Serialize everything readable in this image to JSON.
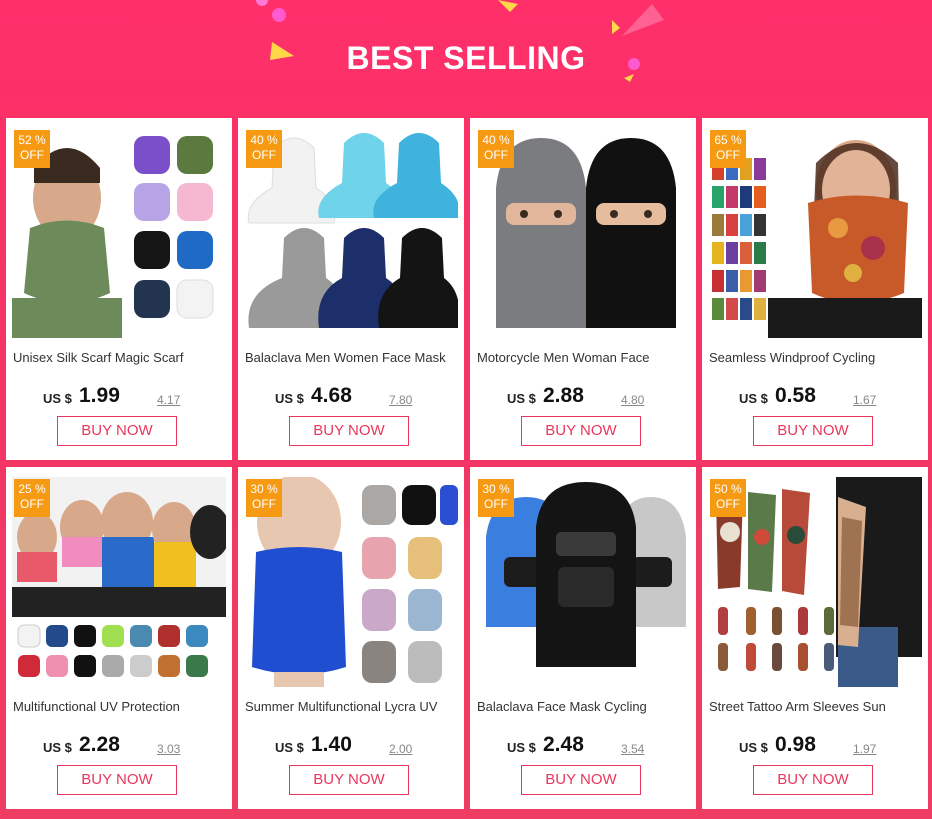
{
  "header": {
    "title": "BEST SELLING"
  },
  "colors": {
    "accent": "#e8385c",
    "badge": "#f59a12",
    "background": "#f43565"
  },
  "products": [
    {
      "badge_pct": "52 %",
      "badge_off": "OFF",
      "name": "Unisex Silk Scarf Magic Scarf",
      "currency": "US $",
      "price": "1.99",
      "old_price": "4.17",
      "buy_label": "BUY NOW",
      "image": "neck-gaiter-colors"
    },
    {
      "badge_pct": "40 %",
      "badge_off": "OFF",
      "name": "Balaclava Men Women Face Mask",
      "currency": "US $",
      "price": "4.68",
      "old_price": "7.80",
      "buy_label": "BUY NOW",
      "image": "balaclava-colors"
    },
    {
      "badge_pct": "40 %",
      "badge_off": "OFF",
      "name": "Motorcycle Men Woman Face",
      "currency": "US $",
      "price": "2.88",
      "old_price": "4.80",
      "buy_label": "BUY NOW",
      "image": "balaclava-heads"
    },
    {
      "badge_pct": "65 %",
      "badge_off": "OFF",
      "name": "Seamless Windproof Cycling",
      "currency": "US $",
      "price": "0.58",
      "old_price": "1.67",
      "buy_label": "BUY NOW",
      "image": "printed-bandana"
    },
    {
      "badge_pct": "25 %",
      "badge_off": "OFF",
      "name": "Multifunctional UV Protection",
      "currency": "US $",
      "price": "2.28",
      "old_price": "3.03",
      "buy_label": "BUY NOW",
      "image": "uv-scarf-group"
    },
    {
      "badge_pct": "30 %",
      "badge_off": "OFF",
      "name": "Summer Multifunctional Lycra UV",
      "currency": "US $",
      "price": "1.40",
      "old_price": "2.00",
      "buy_label": "BUY NOW",
      "image": "lycra-gaiter"
    },
    {
      "badge_pct": "30 %",
      "badge_off": "OFF",
      "name": "Balaclava Face Mask Cycling",
      "currency": "US $",
      "price": "2.48",
      "old_price": "3.54",
      "buy_label": "BUY NOW",
      "image": "cycling-balaclava"
    },
    {
      "badge_pct": "50 %",
      "badge_off": "OFF",
      "name": "Street Tattoo Arm Sleeves Sun",
      "currency": "US $",
      "price": "0.98",
      "old_price": "1.97",
      "buy_label": "BUY NOW",
      "image": "tattoo-sleeves"
    }
  ]
}
